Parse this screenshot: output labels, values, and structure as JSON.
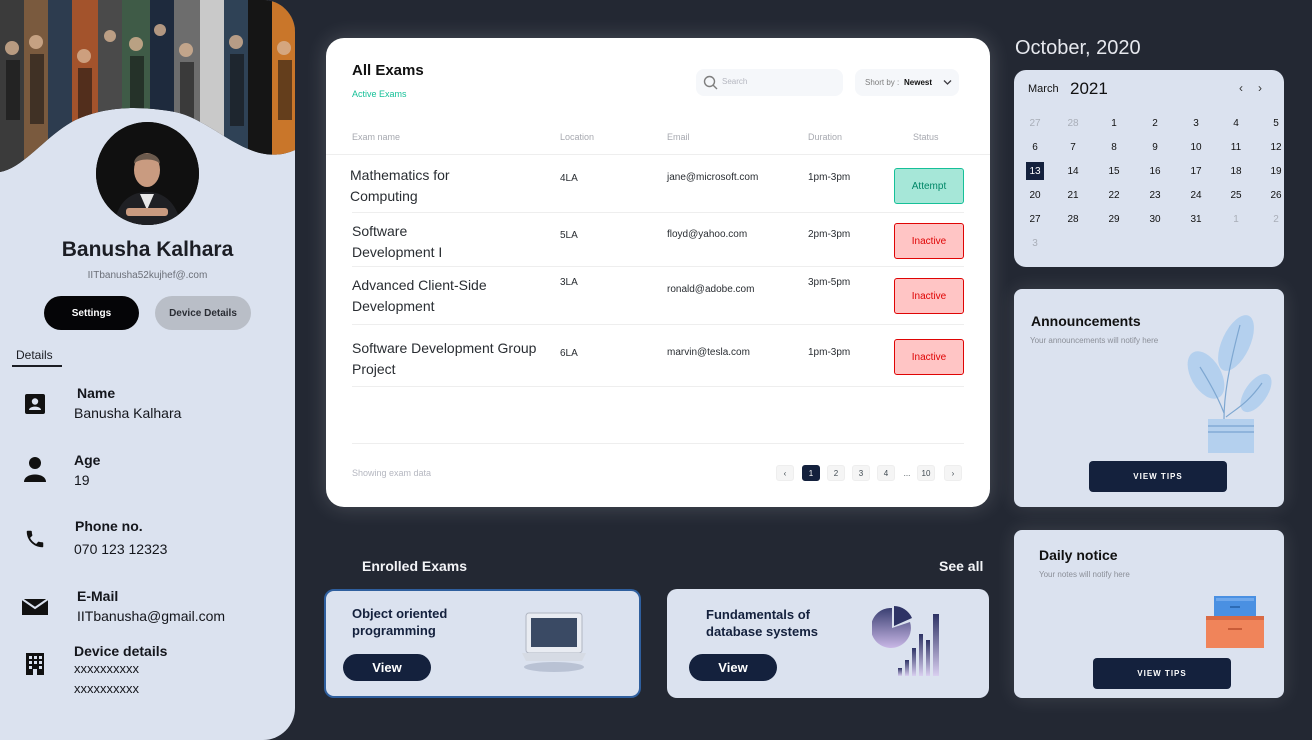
{
  "profile": {
    "name": "Banusha Kalhara",
    "email": "IITbanusha52kujhef@.com",
    "settings_label": "Settings",
    "device_details_label": "Device Details",
    "details_tab": "Details",
    "fields": {
      "name_label": "Name",
      "name_value": "Banusha Kalhara",
      "age_label": "Age",
      "age_value": "19",
      "phone_label": "Phone no.",
      "phone_value": "070 123 12323",
      "email_label": "E-Mail",
      "email_value": "IITbanusha@gmail.com",
      "device_label": "Device details",
      "device_value_1": "xxxxxxxxxx",
      "device_value_2": "xxxxxxxxxx"
    }
  },
  "exams": {
    "title": "All Exams",
    "subtitle": "Active Exams",
    "search_placeholder": "Search",
    "sort_label": "Short by :",
    "sort_value": "Newest",
    "columns": [
      "Exam name",
      "Location",
      "Email",
      "Duration",
      "Status"
    ],
    "rows": [
      {
        "name": "Mathematics for Computing",
        "location": "4LA",
        "email": "jane@microsoft.com",
        "duration": "1pm-3pm",
        "status": "Attempt"
      },
      {
        "name": "Software Development I",
        "location": "5LA",
        "email": "floyd@yahoo.com",
        "duration": "2pm-3pm",
        "status": "Inactive"
      },
      {
        "name": "Advanced Client-Side Development",
        "location": "3LA",
        "email": "ronald@adobe.com",
        "duration": "3pm-5pm",
        "status": "Inactive"
      },
      {
        "name": "Software Development Group Project",
        "location": "6LA",
        "email": "marvin@tesla.com",
        "duration": "1pm-3pm",
        "status": "Inactive"
      }
    ],
    "footer_text": "Showing exam data",
    "pagination": {
      "prev": "‹",
      "pages": [
        "1",
        "2",
        "3",
        "4"
      ],
      "ellipsis": "...",
      "last": "10",
      "next": "›",
      "current": "1"
    }
  },
  "calendar": {
    "heading": "October, 2020",
    "month": "March",
    "year": "2021",
    "prev": "‹",
    "next": "›",
    "today": 13
  },
  "announcements": {
    "title": "Announcements",
    "subtitle": "Your announcements will notify here",
    "button": "VIEW TIPS"
  },
  "daily_notice": {
    "title": "Daily notice",
    "subtitle": "Your notes will notify here",
    "button": "VIEW TIPS"
  },
  "enrolled": {
    "title": "Enrolled Exams",
    "see_all": "See all",
    "courses": [
      {
        "title": "Object oriented programming",
        "button": "View"
      },
      {
        "title": "Fundamentals of database systems",
        "button": "View"
      }
    ]
  },
  "colors": {
    "navy": "#14213d",
    "panel": "#dbe2ef",
    "background": "#232833",
    "attempt_green": "#16c098",
    "inactive_red": "#df0404"
  }
}
